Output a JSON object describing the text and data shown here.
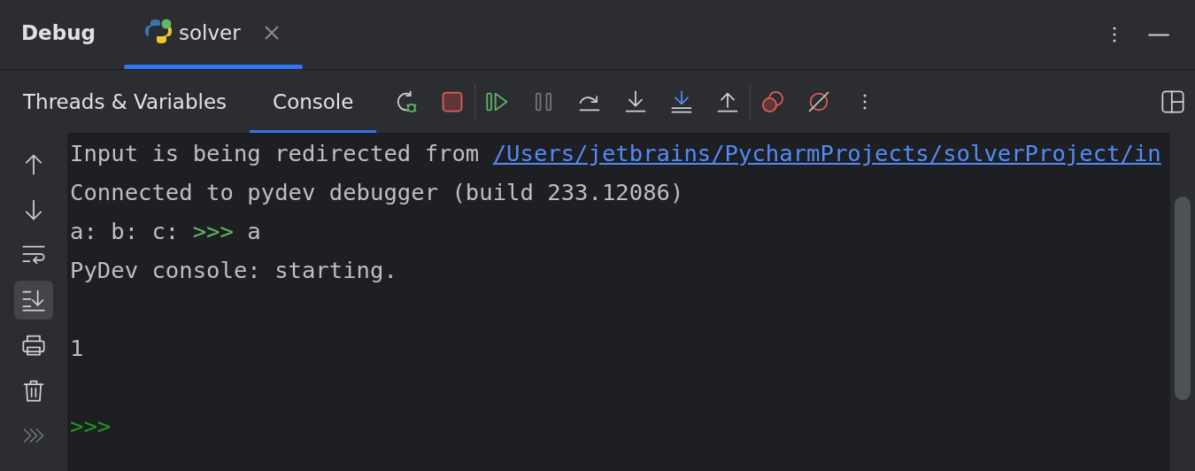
{
  "header": {
    "title": "Debug",
    "sessions": [
      {
        "label": "solver",
        "selected": true
      }
    ]
  },
  "tabs": [
    {
      "label": "Threads & Variables",
      "selected": false
    },
    {
      "label": "Console",
      "selected": true
    }
  ],
  "toolbar": [
    {
      "kind": "rerun",
      "disabled": false
    },
    {
      "kind": "stop",
      "disabled": false
    },
    {
      "kind": "separator"
    },
    {
      "kind": "resume",
      "disabled": false
    },
    {
      "kind": "pause",
      "disabled": true
    },
    {
      "kind": "step_over",
      "disabled": false
    },
    {
      "kind": "step_into",
      "disabled": false
    },
    {
      "kind": "step_into_my_code",
      "disabled": false
    },
    {
      "kind": "step_out",
      "disabled": false
    },
    {
      "kind": "separator"
    },
    {
      "kind": "breakpoints",
      "disabled": false
    },
    {
      "kind": "mute",
      "disabled": false
    },
    {
      "kind": "more",
      "disabled": false
    }
  ],
  "side_toolbar": [
    {
      "kind": "up",
      "selected": false
    },
    {
      "kind": "down",
      "selected": false
    },
    {
      "kind": "wrap",
      "selected": false
    },
    {
      "kind": "scroll_end",
      "selected": true
    },
    {
      "kind": "print",
      "selected": false
    },
    {
      "kind": "trash",
      "selected": false
    },
    {
      "kind": "more",
      "selected": false
    }
  ],
  "console": [
    {
      "kind": "output",
      "segments": [
        {
          "kind": "text",
          "text": "Input is being redirected from "
        },
        {
          "kind": "link",
          "text": "/Users/jetbrains/PycharmProjects/solverProject/in"
        }
      ]
    },
    {
      "kind": "output",
      "segments": [
        {
          "kind": "text",
          "text": "Connected to pydev debugger (build 233.12086)"
        }
      ]
    },
    {
      "kind": "output",
      "segments": [
        {
          "kind": "text",
          "text": "a: b: c: "
        },
        {
          "kind": "prompt",
          "text": ">>>"
        },
        {
          "kind": "text",
          "text": " a"
        }
      ]
    },
    {
      "kind": "output",
      "segments": [
        {
          "kind": "text",
          "text": "PyDev console: starting."
        }
      ]
    },
    {
      "kind": "blank"
    },
    {
      "kind": "output",
      "segments": [
        {
          "kind": "text",
          "text": "1"
        }
      ]
    },
    {
      "kind": "blank"
    },
    {
      "kind": "output",
      "segments": [
        {
          "kind": "active_prompt",
          "text": ">>>"
        }
      ]
    }
  ]
}
